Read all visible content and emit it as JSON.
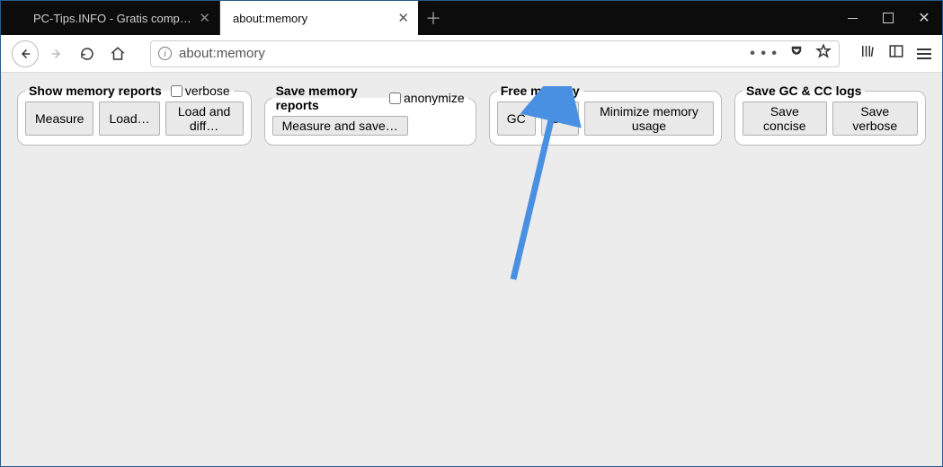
{
  "tabs": {
    "inactive_title": "PC-Tips.INFO - Gratis computer tip…",
    "active_title": "about:memory"
  },
  "urlbar": {
    "value": "about:memory"
  },
  "sections": {
    "show": {
      "legend": "Show memory reports",
      "checkbox_label": "verbose",
      "buttons": {
        "measure": "Measure",
        "load": "Load…",
        "load_diff": "Load and diff…"
      }
    },
    "save": {
      "legend": "Save memory reports",
      "checkbox_label": "anonymize",
      "buttons": {
        "measure_save": "Measure and save…"
      }
    },
    "free": {
      "legend": "Free memory",
      "buttons": {
        "gc": "GC",
        "cc": "CC",
        "min": "Minimize memory usage"
      }
    },
    "logs": {
      "legend": "Save GC & CC logs",
      "buttons": {
        "concise": "Save concise",
        "verbose": "Save verbose"
      }
    }
  }
}
